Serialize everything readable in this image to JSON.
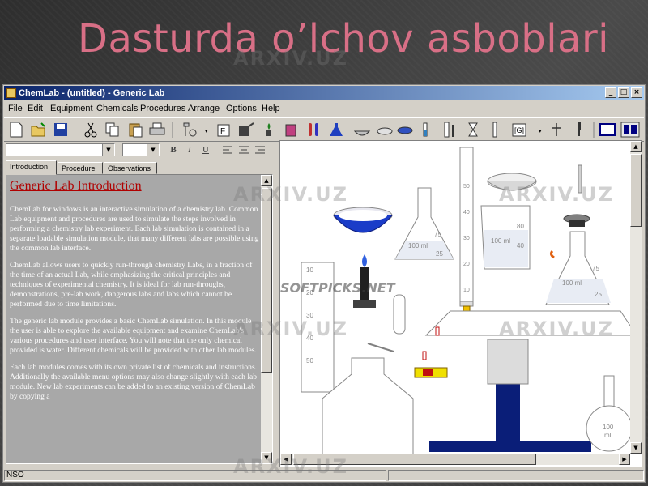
{
  "slide": {
    "title": "Dasturda o’lchov asboblari"
  },
  "window": {
    "title": "ChemLab - (untitled) - Generic Lab",
    "min_label": "_",
    "max_label": "□",
    "close_label": "×"
  },
  "menu": [
    "File",
    "Edit",
    "Equipment",
    "Chemicals",
    "Procedures",
    "Arrange",
    "Options",
    "Help"
  ],
  "toolbar": {
    "icons": [
      "new-icon",
      "open-icon",
      "save-icon",
      "cut-icon",
      "copy-icon",
      "paste-icon",
      "print-icon",
      "pointer-icon",
      "ring-stand-icon",
      "clamp-icon",
      "burner-icon",
      "beaker-icon",
      "test-tube-icon",
      "flask-icon",
      "evaporating-dish-icon",
      "petri-dish-icon",
      "thermometer-icon",
      "graduated-cylinder-icon",
      "burette-icon",
      "balance-icon",
      "funnel-icon",
      "stirring-rod-icon",
      "calculator-icon",
      "pipette-icon",
      "dropper-icon",
      "window-icon",
      "tile-icon"
    ]
  },
  "format_bar": {
    "font_value": "",
    "size_value": "",
    "bold_label": "B",
    "italic_label": "I",
    "underline_label": "U"
  },
  "tabs": [
    {
      "label": "Introduction",
      "active": true
    },
    {
      "label": "Procedure",
      "active": false
    },
    {
      "label": "Observations",
      "active": false
    }
  ],
  "document": {
    "heading": "Generic Lab Introduction",
    "paragraphs": [
      "ChemLab for windows is an interactive simulation of a chemistry lab. Common Lab equipment and procedures are used to simulate the steps involved in performing a chemistry lab experiment. Each lab simulation is contained in a separate loadable simulation module, that many different labs are possible using the common lab interface.",
      "ChemLab allows users to quickly run-through chemistry Labs, in a fraction of the time of an actual Lab, while emphasizing the critical principles and techniques of experimental chemistry. It is ideal for lab run-throughs, demonstrations, pre-lab work, dangerous labs and labs which cannot be performed due to time limitations.",
      "The generic lab module provides a basic ChemLab simulation. In this module the user is able to explore the available equipment and examine ChemLab's various procedures and user interface. You will note that the only chemical provided is water. Different chemicals will be provided with other lab modules.",
      "Each lab modules comes with its own private list of chemicals and instructions. Additionally the available menu options may also change slightly with each lab module. New lab experiments can be added to an existing version of ChemLab by copying a"
    ]
  },
  "lab": {
    "flask_labels": [
      "75",
      "100 ml",
      "25"
    ],
    "beaker_labels": [
      "80",
      "100 ml",
      "40"
    ],
    "flask2_labels": [
      "75",
      "100 ml",
      "25"
    ],
    "cylinder_labels": [
      "50",
      "40",
      "30",
      "20",
      "10"
    ],
    "burette_labels": [
      "10",
      "20",
      "30",
      "40",
      "50"
    ],
    "round_flask_labels": [
      "100",
      "ml"
    ],
    "watermark_soft": "SOFTPICKS.NET"
  },
  "status": {
    "left_text": "NSO"
  },
  "watermarks": [
    "ARXIV.UZ",
    "ARXIV.UZ",
    "ARXIV.UZ",
    "ARXIV.UZ",
    "ARXIV.UZ",
    "ARXIV.UZ"
  ]
}
